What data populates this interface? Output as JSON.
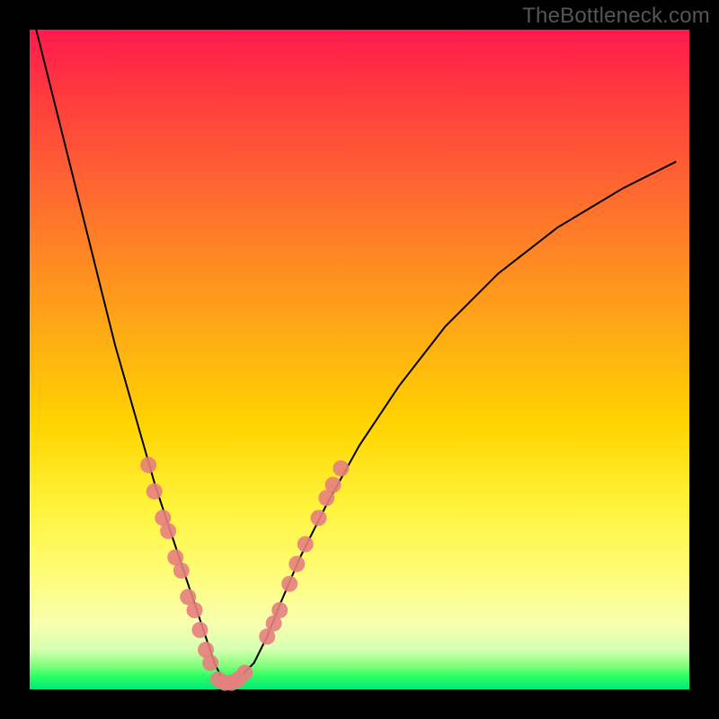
{
  "attribution": "TheBottleneck.com",
  "chart_data": {
    "type": "line",
    "title": "",
    "xlabel": "",
    "ylabel": "",
    "xlim": [
      0,
      100
    ],
    "ylim": [
      0,
      100
    ],
    "legend": false,
    "grid": false,
    "annotations": [],
    "background_gradient": [
      "#ff1a4d",
      "#ff6a2f",
      "#ffd400",
      "#fff33a",
      "#7fff7a",
      "#00e87a"
    ],
    "series": [
      {
        "name": "bottleneck-curve",
        "x": [
          1,
          3,
          5,
          7,
          9,
          11,
          13,
          15,
          17,
          19,
          21,
          23,
          25,
          27,
          28,
          29,
          30,
          31,
          32,
          34,
          36,
          38,
          41,
          45,
          50,
          56,
          63,
          71,
          80,
          90,
          98
        ],
        "y": [
          100,
          92,
          84,
          76,
          68,
          60,
          52,
          45,
          38,
          31,
          25,
          19,
          13,
          7,
          4,
          2,
          1,
          1,
          2,
          4,
          8,
          13,
          20,
          28,
          37,
          46,
          55,
          63,
          70,
          76,
          80
        ]
      }
    ],
    "scatter_markers": {
      "name": "highlight-dots",
      "color": "#e58080",
      "radius_px": 9,
      "points": [
        {
          "x": 18.0,
          "y": 34
        },
        {
          "x": 18.9,
          "y": 30
        },
        {
          "x": 20.2,
          "y": 26
        },
        {
          "x": 21.0,
          "y": 24
        },
        {
          "x": 22.1,
          "y": 20
        },
        {
          "x": 23.0,
          "y": 18
        },
        {
          "x": 24.0,
          "y": 14
        },
        {
          "x": 25.0,
          "y": 12
        },
        {
          "x": 25.8,
          "y": 9
        },
        {
          "x": 26.7,
          "y": 6
        },
        {
          "x": 27.4,
          "y": 4
        },
        {
          "x": 28.6,
          "y": 1.5
        },
        {
          "x": 29.6,
          "y": 1
        },
        {
          "x": 30.6,
          "y": 1
        },
        {
          "x": 31.6,
          "y": 1.5
        },
        {
          "x": 32.6,
          "y": 2.5
        },
        {
          "x": 36.0,
          "y": 8
        },
        {
          "x": 37.0,
          "y": 10
        },
        {
          "x": 37.9,
          "y": 12
        },
        {
          "x": 39.4,
          "y": 16
        },
        {
          "x": 40.5,
          "y": 19
        },
        {
          "x": 41.8,
          "y": 22
        },
        {
          "x": 43.8,
          "y": 26
        },
        {
          "x": 45.0,
          "y": 29
        },
        {
          "x": 46.0,
          "y": 31
        },
        {
          "x": 47.2,
          "y": 33.5
        }
      ]
    }
  }
}
